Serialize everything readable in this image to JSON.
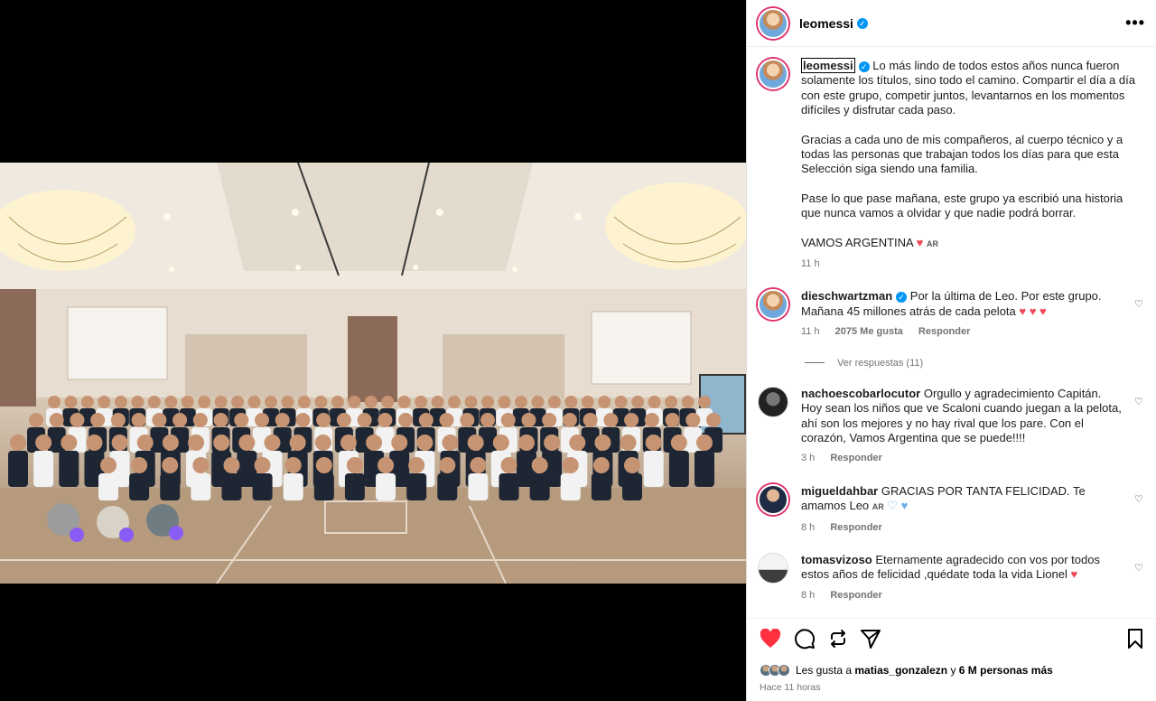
{
  "post": {
    "username": "leomessi",
    "verified_mark": "✓",
    "more_label": "•••"
  },
  "caption": {
    "username": "leomessi",
    "paragraphs": [
      "Lo más lindo de todos estos años nunca fueron solamente los títulos, sino todo el camino. Compartir el día a día con este grupo, competir juntos, levantarnos en los momentos difíciles y disfrutar cada paso.",
      "Gracias a cada uno de mis compañeros, al cuerpo técnico y a todas las personas que trabajan todos los días para que esta Selección siga siendo una familia.",
      "Pase lo que pase mañana, este grupo ya escribió una historia que nunca vamos a olvidar y que nadie podrá borrar."
    ],
    "closing": "VAMOS ARGENTINA",
    "closing_emoji": "♥",
    "flag": "AR",
    "time": "11 h"
  },
  "comments": [
    {
      "username": "dieschwartzman",
      "verified": true,
      "text": "Por la última de Leo. Por este grupo. Mañana 45 millones atrás de cada pelota",
      "emoji": "♥ ♥ ♥",
      "time": "11 h",
      "likes": "2075 Me gusta",
      "reply": "Responder",
      "view_replies": "Ver respuestas (11)"
    },
    {
      "username": "nachoescobarlocutor",
      "text": "Orgullo y agradecimiento Capitán. Hoy sean los niños que ve Scaloni cuando juegan a la pelota, ahí son los mejores y no hay rival que los pare. Con el corazón, Vamos Argentina que se puede!!!!",
      "time": "3 h",
      "reply": "Responder"
    },
    {
      "username": "migueldahbar",
      "text": "GRACIAS POR TANTA FELICIDAD. Te amamos Leo",
      "flag": "AR",
      "emoji": "♡ ♥",
      "time": "8 h",
      "reply": "Responder"
    },
    {
      "username": "tomasvizoso",
      "text": "Eternamente agradecido con vos por todos estos años de felicidad ,quédate toda la vida Lionel",
      "emoji": "♥",
      "time": "8 h",
      "reply": "Responder"
    }
  ],
  "likes": {
    "prefix": "Les gusta a",
    "user": "matias_gonzalezn",
    "middle": "y",
    "count": "6 M personas más"
  },
  "posted": "Hace 11 horas",
  "colors": {
    "like_red": "#ed4956",
    "verified_blue": "#0095f6"
  }
}
